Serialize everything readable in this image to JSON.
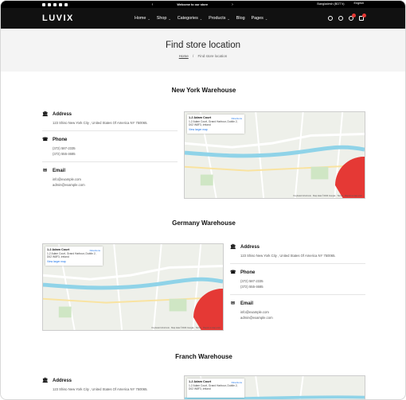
{
  "topbar": {
    "promo": "Welcome to our store",
    "country": "Bangladesh (BDT ৳)",
    "language": "English"
  },
  "nav": {
    "logo": "LUVIX",
    "menu": [
      {
        "label": "Home"
      },
      {
        "label": "Shop"
      },
      {
        "label": "Categories"
      },
      {
        "label": "Products"
      },
      {
        "label": "Blog"
      },
      {
        "label": "Pages"
      }
    ]
  },
  "page": {
    "title": "Find store location",
    "breadcrumb_home": "Home",
    "breadcrumb_sep": "/",
    "breadcrumb_current": "Find store location"
  },
  "map_box": {
    "title": "1-2 Adam Court",
    "addr": "1-2 Adam Court, Grand Harbour, Dublin 2, D02 W8F3, Ireland",
    "larger": "View larger map",
    "directions": "Directions",
    "footer": "Keyboard shortcuts · Map data ©2024 Google · Terms · Report a map error"
  },
  "sections": [
    {
      "title": "New York Warehouse",
      "address_label": "Address",
      "address": "123 Shiso New York City , United States Of America NY 750065.",
      "phone_label": "Phone",
      "phones": [
        "(372) 587-2335",
        "(372) 555-4685"
      ],
      "email_label": "Email",
      "emails": [
        "info@example.com",
        "admin@example.com"
      ]
    },
    {
      "title": "Germany Warehouse",
      "address_label": "Address",
      "address": "123 Shiso New York City , United States Of America NY 750065.",
      "phone_label": "Phone",
      "phones": [
        "(372) 587-2335",
        "(372) 555-4685"
      ],
      "email_label": "Email",
      "emails": [
        "info@example.com",
        "admin@example.com"
      ]
    },
    {
      "title": "Franch Warehouse",
      "address_label": "Address",
      "address": "123 Shiso New York City , United States Of America NY 750065."
    }
  ]
}
